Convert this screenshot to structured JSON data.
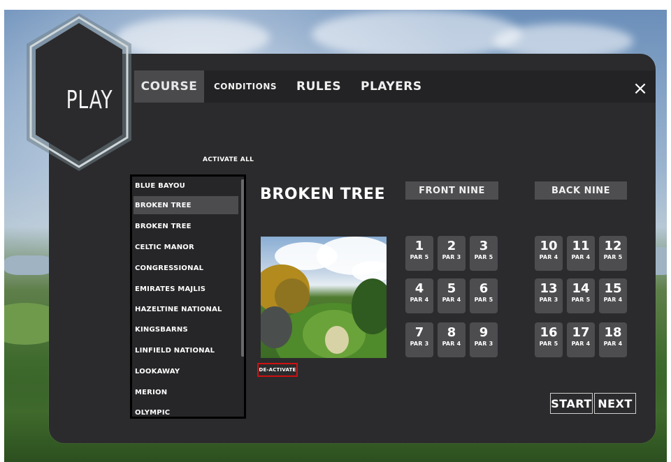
{
  "header": {
    "play_label": "PLAY",
    "tabs": [
      {
        "label": "COURSE",
        "active": true
      },
      {
        "label": "CONDITIONS",
        "active": false
      },
      {
        "label": "RULES",
        "active": false
      },
      {
        "label": "PLAYERS",
        "active": false
      }
    ],
    "close_label": "×"
  },
  "course_list": {
    "activate_all_label": "ACTIVATE ALL",
    "items": [
      "BLUE BAYOU",
      "BROKEN TREE",
      "BROKEN TREE",
      "CELTIC MANOR",
      "CONGRESSIONAL",
      "EMIRATES MAJLIS",
      "HAZELTINE NATIONAL",
      "KINGSBARNS",
      "LINFIELD NATIONAL",
      "LOOKAWAY",
      "MERION",
      "OLYMPIC"
    ],
    "selected_index": 1
  },
  "course_detail": {
    "title": "BROKEN TREE",
    "deactivate_label": "DE-ACTIVATE"
  },
  "front_nine": {
    "label": "FRONT NINE",
    "holes": [
      {
        "num": "1",
        "par": "PAR 5"
      },
      {
        "num": "2",
        "par": "PAR 3"
      },
      {
        "num": "3",
        "par": "PAR 5"
      },
      {
        "num": "4",
        "par": "PAR 4"
      },
      {
        "num": "5",
        "par": "PAR 4"
      },
      {
        "num": "6",
        "par": "PAR 5"
      },
      {
        "num": "7",
        "par": "PAR 3"
      },
      {
        "num": "8",
        "par": "PAR 4"
      },
      {
        "num": "9",
        "par": "PAR 3"
      }
    ]
  },
  "back_nine": {
    "label": "BACK NINE",
    "holes": [
      {
        "num": "10",
        "par": "PAR 4"
      },
      {
        "num": "11",
        "par": "PAR 4"
      },
      {
        "num": "12",
        "par": "PAR 5"
      },
      {
        "num": "13",
        "par": "PAR 3"
      },
      {
        "num": "14",
        "par": "PAR 5"
      },
      {
        "num": "15",
        "par": "PAR 4"
      },
      {
        "num": "16",
        "par": "PAR 5"
      },
      {
        "num": "17",
        "par": "PAR 4"
      },
      {
        "num": "18",
        "par": "PAR 4"
      }
    ]
  },
  "actions": {
    "start_label": "START",
    "next_label": "NEXT"
  },
  "colors": {
    "panel": "#2b2b2d",
    "tab_active": "#4a4a4d",
    "hole_bg": "#4d4d50",
    "deactivate_border": "#d01010"
  }
}
